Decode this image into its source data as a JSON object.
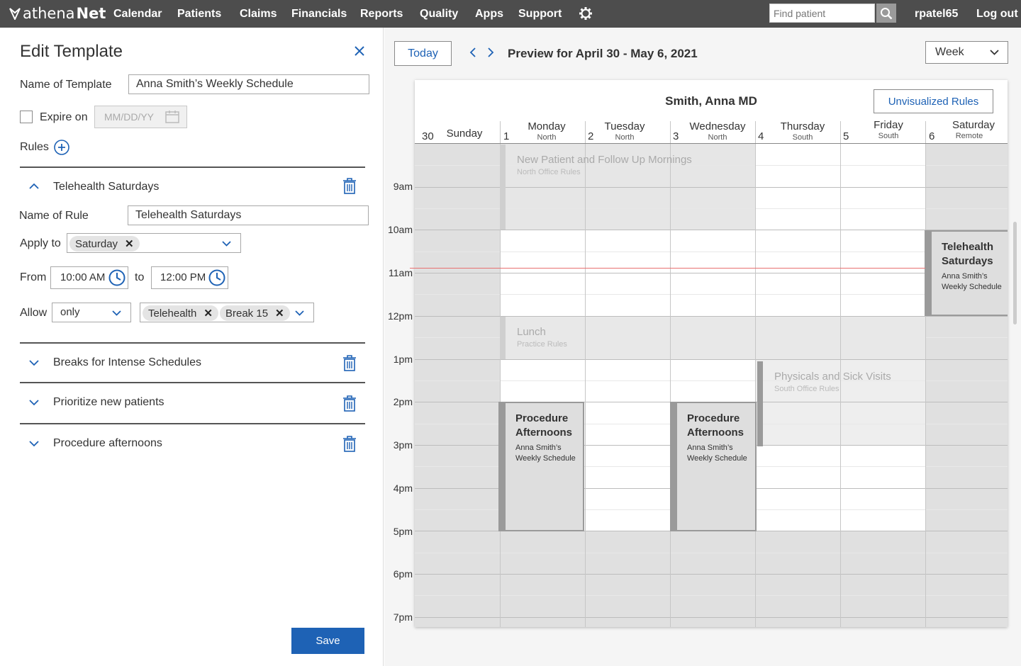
{
  "nav": {
    "logo_a": "athena",
    "logo_b": "Net",
    "items": [
      "Calendar",
      "Patients",
      "Claims",
      "Financials",
      "Reports",
      "Quality",
      "Apps",
      "Support"
    ],
    "search_placeholder": "Find patient",
    "user": "rpatel65",
    "logout": "Log out"
  },
  "template": {
    "title": "Edit Template",
    "name_label": "Name of Template",
    "name_value": "Anna Smith’s Weekly Schedule",
    "expire_label": "Expire on",
    "expire_placeholder": "MM/DD/YY",
    "rules_label": "Rules",
    "save": "Save"
  },
  "rules": [
    {
      "title": "Telehealth Saturdays",
      "expanded": true,
      "name_label": "Name of Rule",
      "name_value": "Telehealth Saturdays",
      "apply_label": "Apply to",
      "apply_chip": "Saturday",
      "from_label": "From",
      "from_value": "10:00 AM",
      "to_label": "to",
      "to_value": "12:00 PM",
      "allow_label": "Allow",
      "allow_value": "only",
      "allow_chips": [
        "Telehealth",
        "Break 15"
      ]
    },
    {
      "title": "Breaks for Intense Schedules",
      "expanded": false
    },
    {
      "title": "Prioritize new patients",
      "expanded": false
    },
    {
      "title": "Procedure afternoons",
      "expanded": false
    }
  ],
  "preview": {
    "today": "Today",
    "range": "Preview for April 30 -  May 6, 2021",
    "view": "Week",
    "provider": "Smith, Anna MD",
    "unvisualized": "Unvisualized Rules",
    "days": [
      {
        "num": "30",
        "name": "Sunday",
        "loc": ""
      },
      {
        "num": "1",
        "name": "Monday",
        "loc": "North"
      },
      {
        "num": "2",
        "name": "Tuesday",
        "loc": "North"
      },
      {
        "num": "3",
        "name": "Wednesday",
        "loc": "North"
      },
      {
        "num": "4",
        "name": "Thursday",
        "loc": "South"
      },
      {
        "num": "5",
        "name": "Friday",
        "loc": "South"
      },
      {
        "num": "6",
        "name": "Saturday",
        "loc": "Remote"
      }
    ],
    "times": [
      "9am",
      "10am",
      "11am",
      "12pm",
      "1pm",
      "2pm",
      "3pm",
      "4pm",
      "5pm",
      "6pm",
      "7pm"
    ],
    "blocks": {
      "np_title": "New Patient and Follow Up Mornings",
      "np_sub": "North Office Rules",
      "lunch_title": "Lunch",
      "lunch_sub": "Practice Rules",
      "phys_title": "Physicals and Sick Visits",
      "phys_sub": "South Office Rules",
      "proc_title": "Procedure Afternoons",
      "proc_sub": "Anna Smith’s Weekly Schedule",
      "tele_title": "Telehealth Saturdays",
      "tele_sub": "Anna Smith’s Weekly Schedule"
    }
  }
}
